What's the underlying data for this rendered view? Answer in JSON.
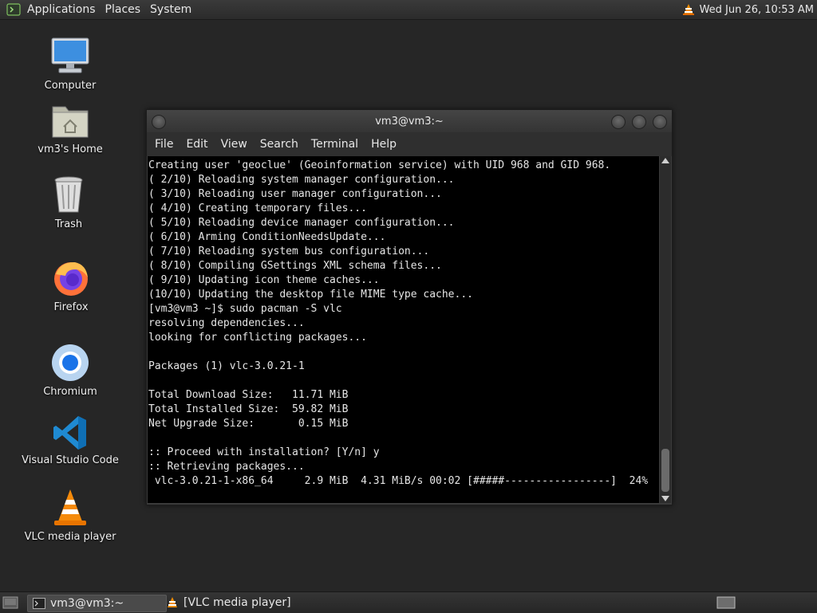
{
  "top_panel": {
    "menus": [
      "Applications",
      "Places",
      "System"
    ],
    "clock": "Wed Jun 26, 10:53 AM"
  },
  "desktop": {
    "icons": [
      {
        "label": "Computer",
        "icon": "computer-icon"
      },
      {
        "label": "vm3's Home",
        "icon": "home-folder-icon"
      },
      {
        "label": "Trash",
        "icon": "trash-icon"
      },
      {
        "label": "Firefox",
        "icon": "firefox-icon"
      },
      {
        "label": "Chromium",
        "icon": "chromium-icon"
      },
      {
        "label": "Visual Studio Code",
        "icon": "vscode-icon"
      },
      {
        "label": "VLC media player",
        "icon": "vlc-icon"
      }
    ]
  },
  "terminal": {
    "title": "vm3@vm3:~",
    "menu": [
      "File",
      "Edit",
      "View",
      "Search",
      "Terminal",
      "Help"
    ],
    "lines": [
      "Creating user 'geoclue' (Geoinformation service) with UID 968 and GID 968.",
      "( 2/10) Reloading system manager configuration...",
      "( 3/10) Reloading user manager configuration...",
      "( 4/10) Creating temporary files...",
      "( 5/10) Reloading device manager configuration...",
      "( 6/10) Arming ConditionNeedsUpdate...",
      "( 7/10) Reloading system bus configuration...",
      "( 8/10) Compiling GSettings XML schema files...",
      "( 9/10) Updating icon theme caches...",
      "(10/10) Updating the desktop file MIME type cache...",
      "[vm3@vm3 ~]$ sudo pacman -S vlc",
      "resolving dependencies...",
      "looking for conflicting packages...",
      "",
      "Packages (1) vlc-3.0.21-1",
      "",
      "Total Download Size:   11.71 MiB",
      "Total Installed Size:  59.82 MiB",
      "Net Upgrade Size:       0.15 MiB",
      "",
      ":: Proceed with installation? [Y/n] y",
      ":: Retrieving packages...",
      " vlc-3.0.21-1-x86_64     2.9 MiB  4.31 MiB/s 00:02 [#####-----------------]  24%"
    ]
  },
  "taskbar": {
    "tasks": [
      {
        "label": "vm3@vm3:~",
        "icon": "terminal-icon",
        "active": true
      },
      {
        "label": "[VLC media player]",
        "icon": "vlc-icon",
        "active": false
      }
    ]
  }
}
